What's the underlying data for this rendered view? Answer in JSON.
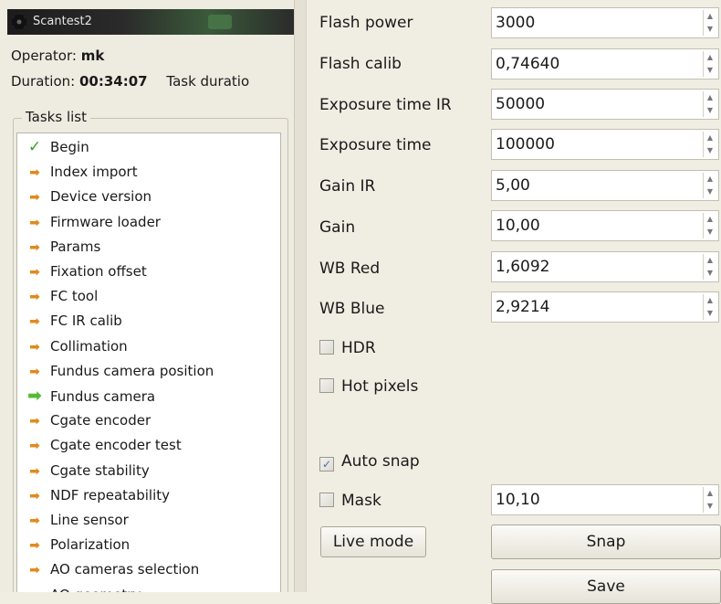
{
  "window": {
    "title": "Scantest2"
  },
  "session": {
    "operator_label": "Operator:",
    "operator": "mk",
    "duration_label": "Duration:",
    "duration": "00:34:07",
    "task_duration_label": "Task duratio"
  },
  "tasks": {
    "legend": "Tasks list",
    "items": [
      {
        "label": "Begin",
        "icon": "check-icon",
        "status": "done"
      },
      {
        "label": "Index import",
        "icon": "arrow-right-icon",
        "status": "pending"
      },
      {
        "label": "Device version",
        "icon": "arrow-right-icon",
        "status": "pending"
      },
      {
        "label": "Firmware loader",
        "icon": "arrow-right-icon",
        "status": "pending"
      },
      {
        "label": "Params",
        "icon": "arrow-right-icon",
        "status": "pending"
      },
      {
        "label": "Fixation offset",
        "icon": "arrow-right-icon",
        "status": "pending"
      },
      {
        "label": "FC tool",
        "icon": "arrow-right-icon",
        "status": "pending"
      },
      {
        "label": "FC IR calib",
        "icon": "arrow-right-icon",
        "status": "pending"
      },
      {
        "label": "Collimation",
        "icon": "arrow-right-icon",
        "status": "pending"
      },
      {
        "label": "Fundus camera position",
        "icon": "arrow-right-icon",
        "status": "pending"
      },
      {
        "label": "Fundus camera",
        "icon": "current-arrow-icon",
        "status": "current"
      },
      {
        "label": "Cgate encoder",
        "icon": "arrow-right-icon",
        "status": "pending"
      },
      {
        "label": "Cgate encoder test",
        "icon": "arrow-right-icon",
        "status": "pending"
      },
      {
        "label": "Cgate stability",
        "icon": "arrow-right-icon",
        "status": "pending"
      },
      {
        "label": "NDF repeatability",
        "icon": "arrow-right-icon",
        "status": "pending"
      },
      {
        "label": "Line sensor",
        "icon": "arrow-right-icon",
        "status": "pending"
      },
      {
        "label": "Polarization",
        "icon": "arrow-right-icon",
        "status": "pending"
      },
      {
        "label": "AO cameras selection",
        "icon": "arrow-right-icon",
        "status": "pending"
      },
      {
        "label": "AO geometry",
        "icon": "arrow-right-icon",
        "status": "pending"
      }
    ]
  },
  "params": {
    "flash_power": {
      "label": "Flash power",
      "value": "3000"
    },
    "flash_calib": {
      "label": "Flash calib",
      "value": "0,74640"
    },
    "exposure_time_ir": {
      "label": "Exposure time IR",
      "value": "50000"
    },
    "exposure_time": {
      "label": "Exposure time",
      "value": "100000"
    },
    "gain_ir": {
      "label": "Gain IR",
      "value": "5,00"
    },
    "gain": {
      "label": "Gain",
      "value": "10,00"
    },
    "wb_red": {
      "label": "WB Red",
      "value": "1,6092"
    },
    "wb_blue": {
      "label": "WB Blue",
      "value": "2,9214"
    }
  },
  "options": {
    "hdr": {
      "label": "HDR",
      "checked": false
    },
    "hot_pixels": {
      "label": "Hot pixels",
      "checked": false
    },
    "auto_snap": {
      "label": "Auto snap",
      "checked": true
    },
    "mask": {
      "label": "Mask",
      "checked": false,
      "value": "10,10"
    }
  },
  "buttons": {
    "live_mode": "Live mode",
    "snap": "Snap",
    "save": "Save"
  },
  "icons": {
    "spin_up": "▲",
    "spin_down": "▼",
    "check_mark": "✓",
    "task_arrow": "➡",
    "task_check": "✓"
  },
  "colors": {
    "done_check": "#3aa02a",
    "pending_arrow": "#e08a1e",
    "current_arrow": "#55bb33"
  }
}
